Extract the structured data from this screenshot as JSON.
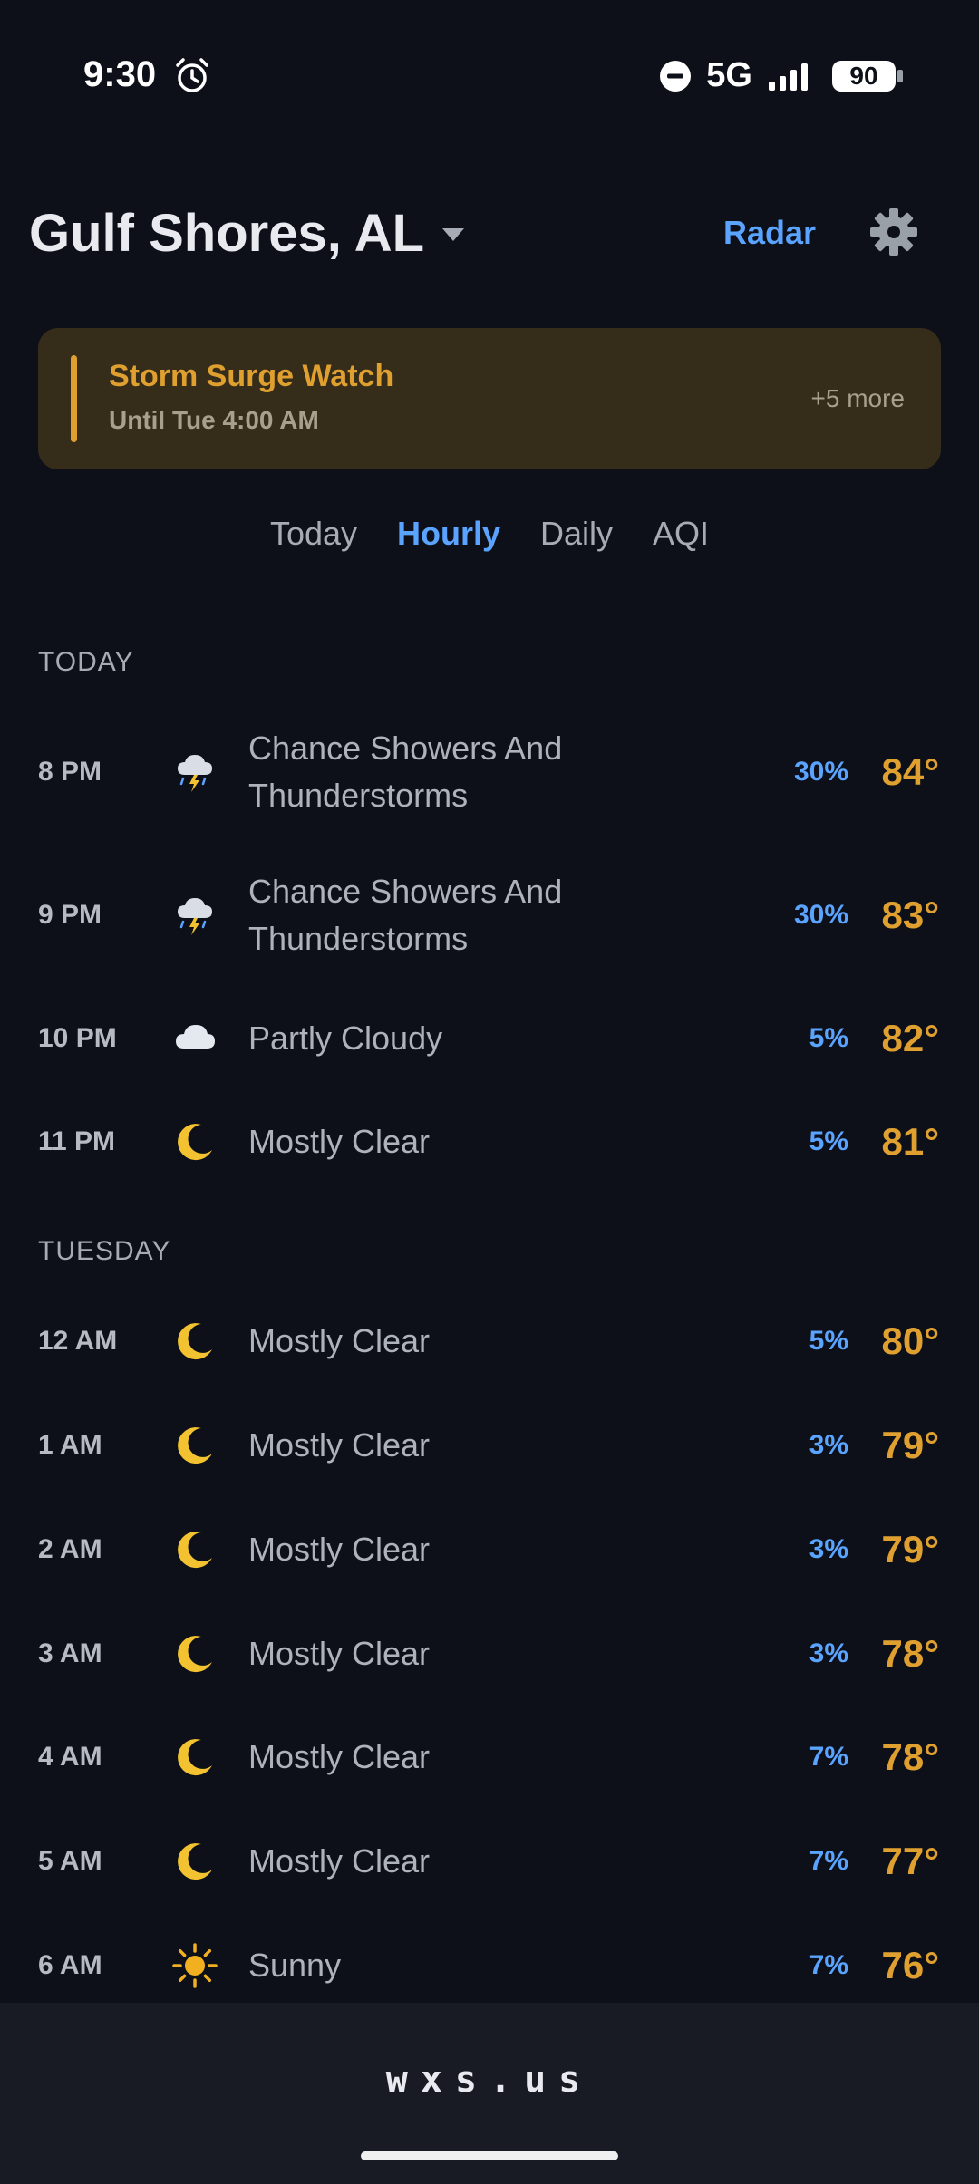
{
  "status": {
    "time": "9:30",
    "network": "5G",
    "battery": "90"
  },
  "header": {
    "location": "Gulf Shores, AL",
    "radar_label": "Radar"
  },
  "alert": {
    "title": "Storm Surge Watch",
    "subtitle": "Until Tue 4:00 AM",
    "more": "+5 more"
  },
  "tabs": [
    {
      "label": "Today"
    },
    {
      "label": "Hourly"
    },
    {
      "label": "Daily"
    },
    {
      "label": "AQI"
    }
  ],
  "sections": {
    "today": "TODAY",
    "tuesday": "TUESDAY"
  },
  "rows": [
    {
      "time": "8 PM",
      "icon": "thunderstorm-icon",
      "cond": "Chance Showers And Thunderstorms",
      "pop": "30%",
      "temp": "84°"
    },
    {
      "time": "9 PM",
      "icon": "thunderstorm-icon",
      "cond": "Chance Showers And Thunderstorms",
      "pop": "30%",
      "temp": "83°"
    },
    {
      "time": "10 PM",
      "icon": "cloud-icon",
      "cond": "Partly Cloudy",
      "pop": "5%",
      "temp": "82°"
    },
    {
      "time": "11 PM",
      "icon": "moon-icon",
      "cond": "Mostly Clear",
      "pop": "5%",
      "temp": "81°"
    },
    {
      "time": "12 AM",
      "icon": "moon-icon",
      "cond": "Mostly Clear",
      "pop": "5%",
      "temp": "80°"
    },
    {
      "time": "1 AM",
      "icon": "moon-icon",
      "cond": "Mostly Clear",
      "pop": "3%",
      "temp": "79°"
    },
    {
      "time": "2 AM",
      "icon": "moon-icon",
      "cond": "Mostly Clear",
      "pop": "3%",
      "temp": "79°"
    },
    {
      "time": "3 AM",
      "icon": "moon-icon",
      "cond": "Mostly Clear",
      "pop": "3%",
      "temp": "78°"
    },
    {
      "time": "4 AM",
      "icon": "moon-icon",
      "cond": "Mostly Clear",
      "pop": "7%",
      "temp": "78°"
    },
    {
      "time": "5 AM",
      "icon": "moon-icon",
      "cond": "Mostly Clear",
      "pop": "7%",
      "temp": "77°"
    },
    {
      "time": "6 AM",
      "icon": "sun-icon",
      "cond": "Sunny",
      "pop": "7%",
      "temp": "76°"
    }
  ],
  "footer": {
    "text": "wxs.us"
  },
  "colors": {
    "accent": "#5aa4ff",
    "warning": "#e0a030",
    "background": "#0d1018"
  }
}
